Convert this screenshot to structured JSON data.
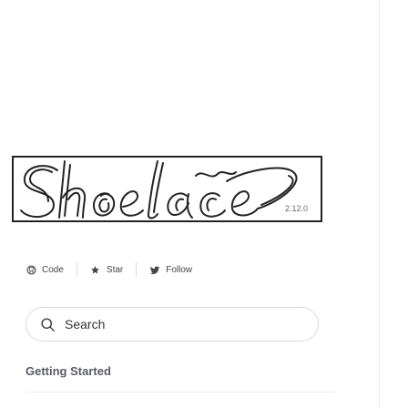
{
  "logo": {
    "version": "2.12.0"
  },
  "social": {
    "code_label": "Code",
    "star_label": "Star",
    "follow_label": "Follow"
  },
  "search": {
    "placeholder": "Search"
  },
  "nav": {
    "section_heading": "Getting Started"
  },
  "colors": {
    "text": "#444444",
    "border": "#d9d9de",
    "heading": "#5a5a66",
    "logo_stroke": "#222222"
  }
}
